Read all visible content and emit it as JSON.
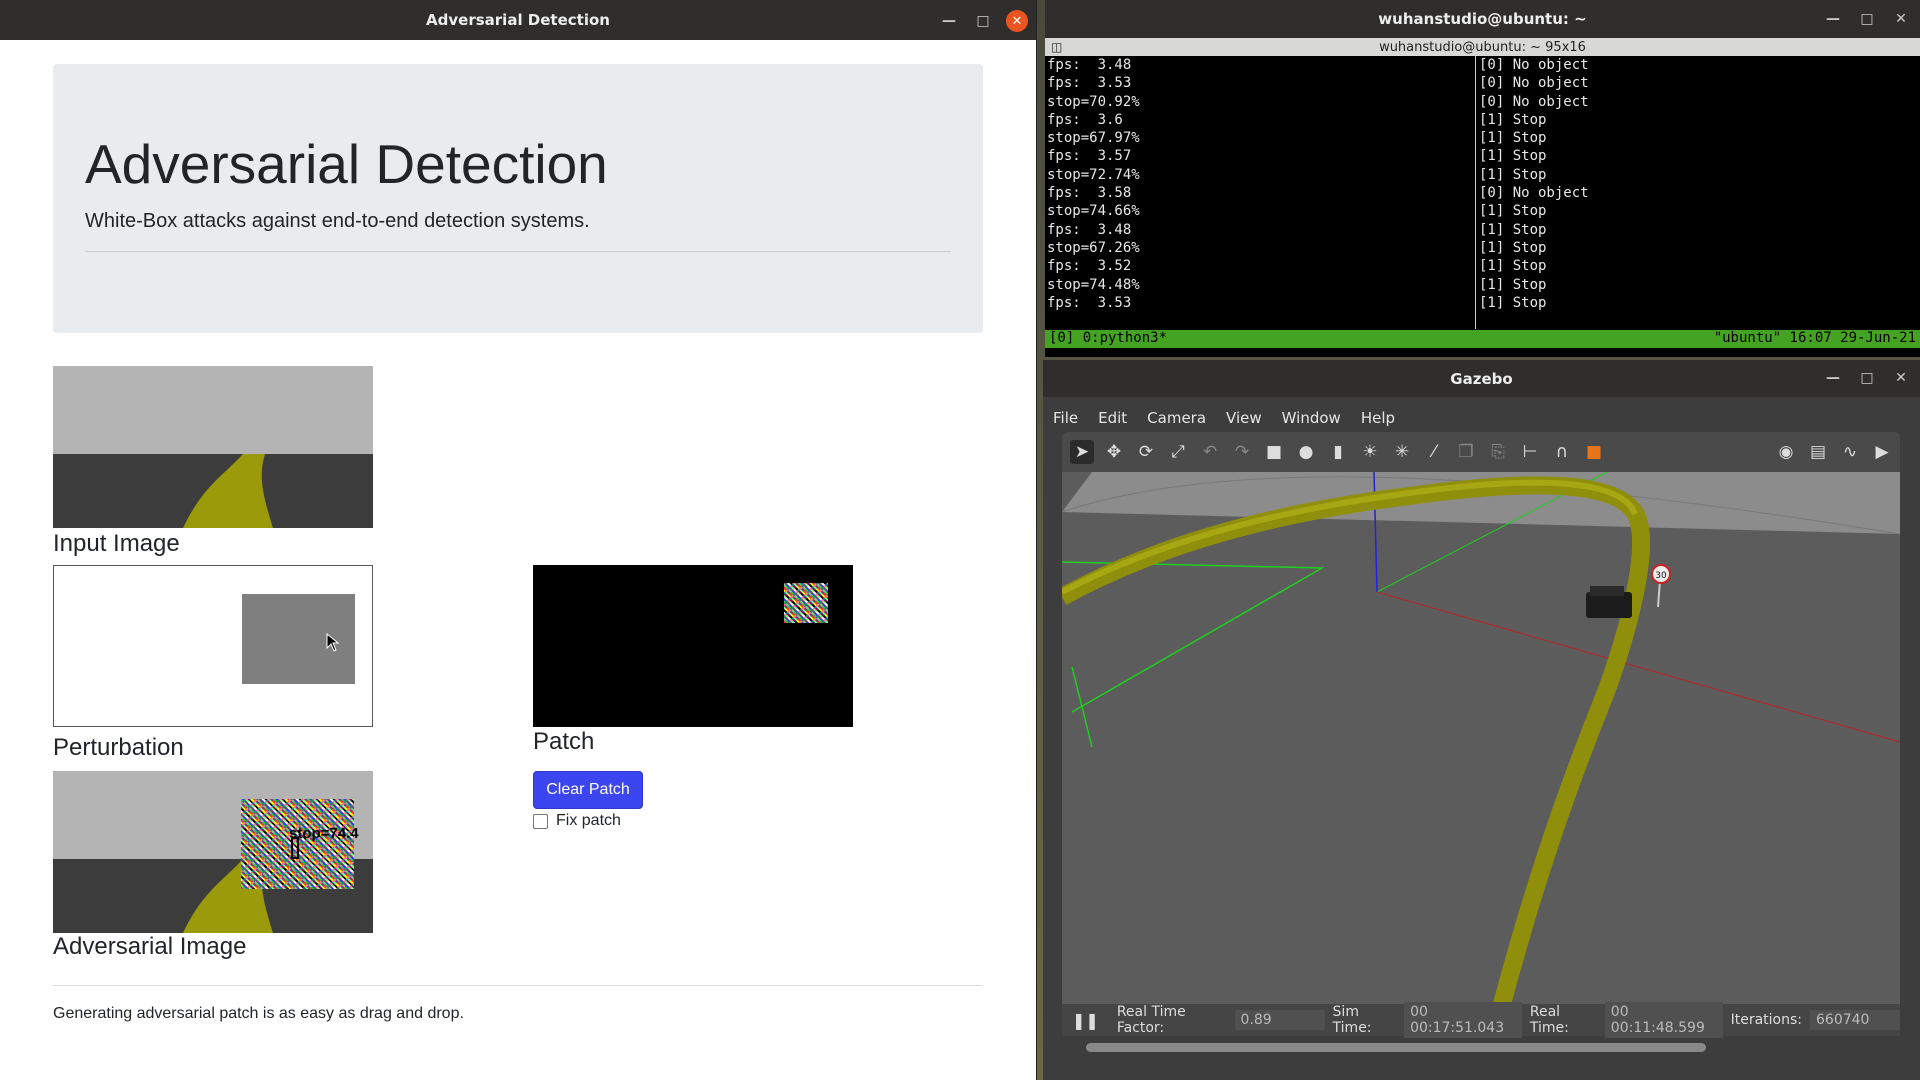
{
  "browser": {
    "window_title": "Adversarial Detection",
    "heading": "Adversarial Detection",
    "lead": "White-Box attacks against end-to-end detection systems.",
    "captions": {
      "input": "Input Image",
      "perturbation": "Perturbation",
      "patch": "Patch",
      "adversarial": "Adversarial Image"
    },
    "overlay_label": "stop=74.4",
    "clear_patch_label": "Clear Patch",
    "fix_patch_label": "Fix patch",
    "footer": "Generating adversarial patch is as easy as drag and drop."
  },
  "terminal": {
    "window_title": "wuhanstudio@ubuntu: ~",
    "subtitle": "wuhanstudio@ubuntu: ~ 95x16",
    "left_lines": [
      "fps:  3.48",
      "fps:  3.53",
      "stop=70.92%",
      "fps:  3.6",
      "stop=67.97%",
      "fps:  3.57",
      "stop=72.74%",
      "fps:  3.58",
      "stop=74.66%",
      "fps:  3.48",
      "stop=67.26%",
      "fps:  3.52",
      "stop=74.48%",
      "fps:  3.53"
    ],
    "right_lines": [
      "[0] No object",
      "[0] No object",
      "[0] No object",
      "[1] Stop",
      "[1] Stop",
      "[1] Stop",
      "[1] Stop",
      "[0] No object",
      "[1] Stop",
      "[1] Stop",
      "[1] Stop",
      "[1] Stop",
      "[1] Stop",
      "[1] Stop"
    ],
    "status_left": "[0] 0:python3*",
    "status_right": "\"ubuntu\" 16:07 29-Jun-21"
  },
  "gazebo": {
    "window_title": "Gazebo",
    "menu": [
      "File",
      "Edit",
      "Camera",
      "View",
      "Window",
      "Help"
    ],
    "sign_label": "30",
    "status": {
      "rtf_label": "Real Time Factor:",
      "rtf_value": "0.89",
      "sim_label": "Sim Time:",
      "sim_value": "00 00:17:51.043",
      "real_label": "Real Time:",
      "real_value": "00 00:11:48.599",
      "iter_label": "Iterations:",
      "iter_value": "660740"
    }
  }
}
